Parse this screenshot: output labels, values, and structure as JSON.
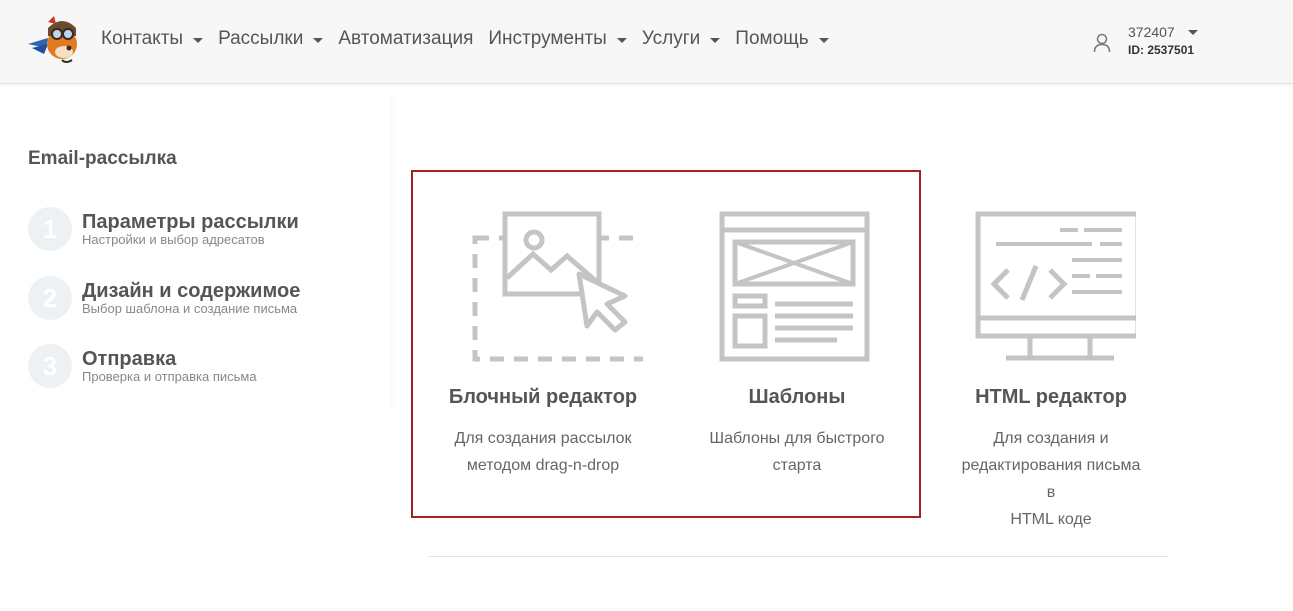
{
  "header": {
    "nav": [
      {
        "label": "Контакты",
        "dropdown": true
      },
      {
        "label": "Рассылки",
        "dropdown": true
      },
      {
        "label": "Автоматизация",
        "dropdown": false
      },
      {
        "label": "Инструменты",
        "dropdown": true
      },
      {
        "label": "Услуги",
        "dropdown": true
      },
      {
        "label": "Помощь",
        "dropdown": true
      }
    ],
    "account": {
      "number": "372407",
      "id": "ID: 2537501"
    }
  },
  "sidebar": {
    "title": "Email-рассылка",
    "steps": [
      {
        "num": "1",
        "title": "Параметры рассылки",
        "subtitle": "Настройки и выбор адресатов"
      },
      {
        "num": "2",
        "title": "Дизайн и содержимое",
        "subtitle": "Выбор шаблона и создание письма"
      },
      {
        "num": "3",
        "title": "Отправка",
        "subtitle": "Проверка и отправка письма"
      }
    ]
  },
  "options": [
    {
      "title": "Блочный редактор",
      "desc1": "Для создания рассылок",
      "desc2": "методом drag-n-drop",
      "desc3": "",
      "icon": "block-editor-icon"
    },
    {
      "title": "Шаблоны",
      "desc1": "Шаблоны для быстрого",
      "desc2": "старта",
      "desc3": "",
      "icon": "templates-icon"
    },
    {
      "title": "HTML редактор",
      "desc1": "Для создания и",
      "desc2": "редактирования письма в",
      "desc3": "HTML коде",
      "icon": "html-editor-icon"
    }
  ],
  "colors": {
    "highlight": "#a52222",
    "icon": "#c4c4c4",
    "text": "#555555"
  }
}
